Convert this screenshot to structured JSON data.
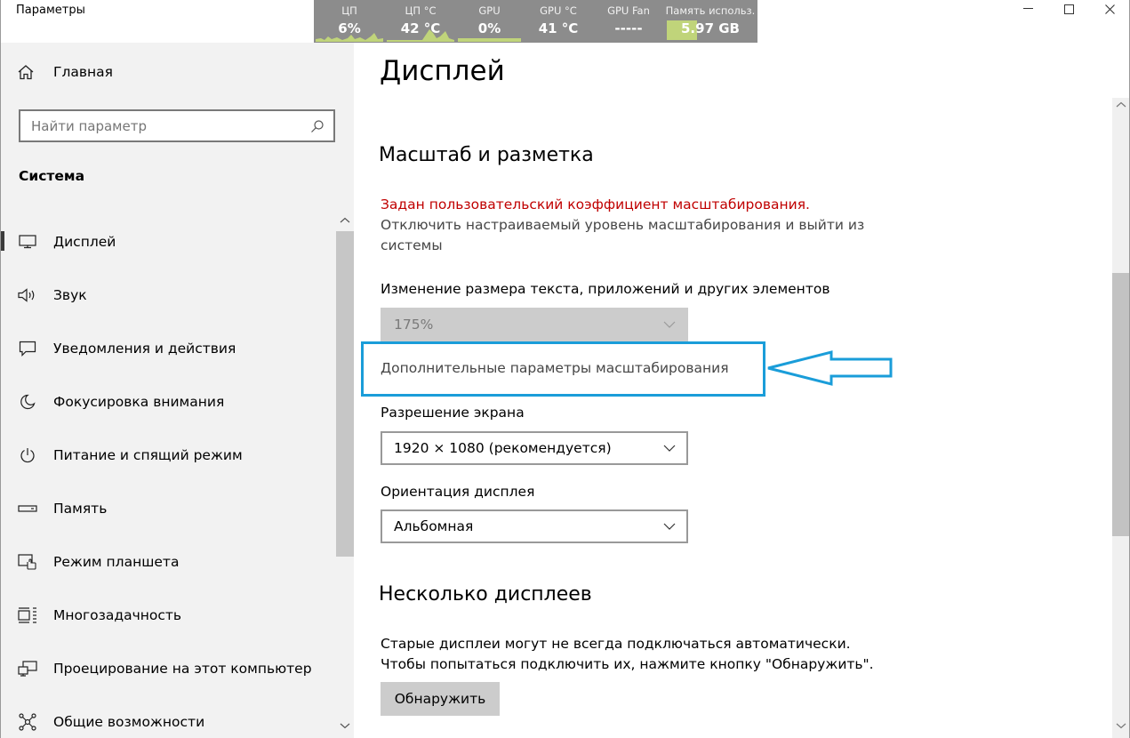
{
  "window": {
    "title": "Параметры",
    "minimize": "—",
    "maximize": "☐",
    "close": "✕"
  },
  "overlay": {
    "items": [
      {
        "label": "ЦП",
        "value": "6%"
      },
      {
        "label": "ЦП °C",
        "value": "42 °C"
      },
      {
        "label": "GPU",
        "value": "0%"
      },
      {
        "label": "GPU °C",
        "value": "41 °C"
      },
      {
        "label": "GPU Fan",
        "value": "-----"
      },
      {
        "label": "Память использ.",
        "value": "5.97 GB"
      }
    ],
    "memory_fill_fraction": 0.35,
    "spark_color": "#c0d47a"
  },
  "sidebar": {
    "home_label": "Главная",
    "search_placeholder": "Найти параметр",
    "section_title": "Система",
    "items": [
      {
        "label": "Дисплей",
        "icon": "monitor-icon"
      },
      {
        "label": "Звук",
        "icon": "speaker-icon"
      },
      {
        "label": "Уведомления и действия",
        "icon": "notification-icon"
      },
      {
        "label": "Фокусировка внимания",
        "icon": "moon-icon"
      },
      {
        "label": "Питание и спящий режим",
        "icon": "power-icon"
      },
      {
        "label": "Память",
        "icon": "storage-icon"
      },
      {
        "label": "Режим планшета",
        "icon": "tablet-icon"
      },
      {
        "label": "Многозадачность",
        "icon": "multitasking-icon"
      },
      {
        "label": "Проецирование на этот компьютер",
        "icon": "projecting-icon"
      },
      {
        "label": "Общие возможности",
        "icon": "shared-icon"
      }
    ]
  },
  "main": {
    "page_title": "Дисплей",
    "scale_section": "Масштаб и разметка",
    "warning": "Задан пользовательский коэффициент масштабирования.",
    "disable_custom": "Отключить настраиваемый уровень масштабирования и выйти из системы",
    "size_label": "Изменение размера текста, приложений и других элементов",
    "size_value": "175%",
    "advanced_link": "Дополнительные параметры масштабирования",
    "resolution_label": "Разрешение экрана",
    "resolution_value": "1920 × 1080 (рекомендуется)",
    "orientation_label": "Ориентация дисплея",
    "orientation_value": "Альбомная",
    "multi_section": "Несколько дисплеев",
    "multi_text_1": "Старые дисплеи могут не всегда подключаться автоматически.",
    "multi_text_2": "Чтобы попытаться подключить их, нажмите кнопку \"Обнаружить\".",
    "detect_button": "Обнаружить"
  },
  "colors": {
    "highlight": "#1a9dd9",
    "warning": "#c00000"
  }
}
